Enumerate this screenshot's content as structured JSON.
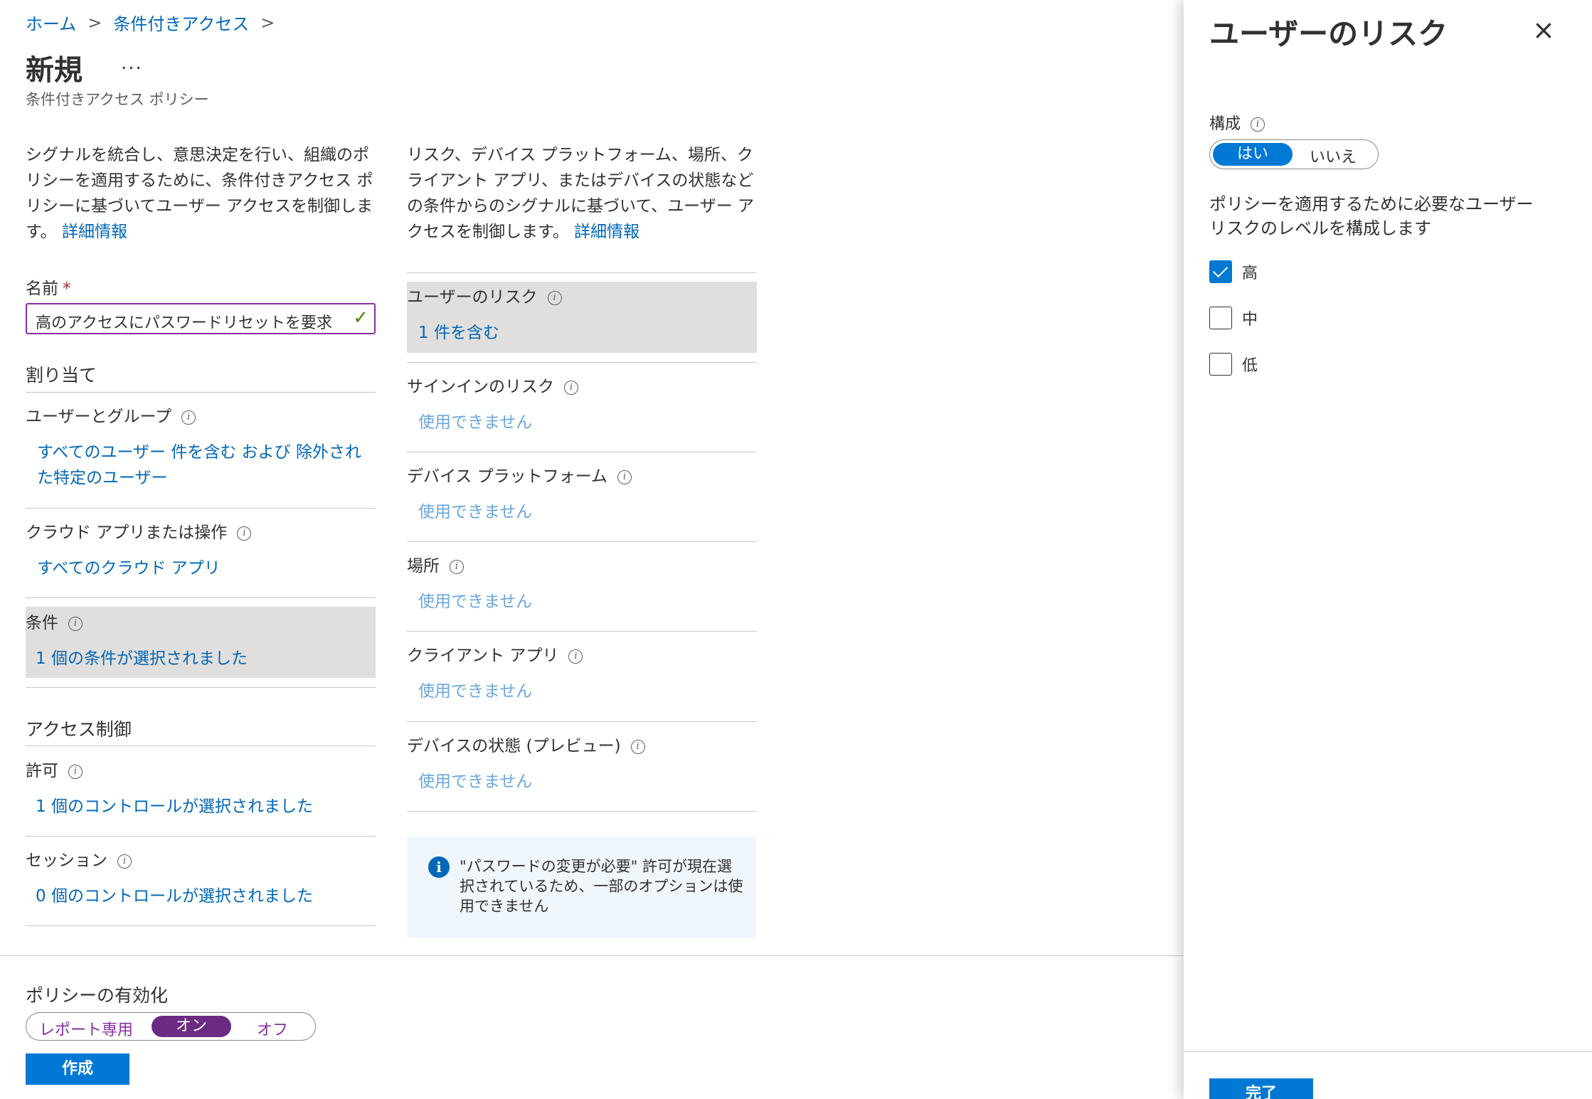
{
  "breadcrumb": {
    "items": [
      "ホーム",
      "条件付きアクセス"
    ],
    "separator": ">"
  },
  "page": {
    "title": "新規",
    "more": "...",
    "subtitle": "条件付きアクセス ポリシー"
  },
  "left": {
    "description": "シグナルを統合し、意思決定を行い、組織のポリシーを適用するために、条件付きアクセス ポリシーに基づいてユーザー アクセスを制御します。",
    "learn_more": "詳細情報",
    "name_label": "名前",
    "name_required": "*",
    "name_value": "高のアクセスにパスワードリセットを要求",
    "assign_heading": "割り当て",
    "users_label": "ユーザーとグループ",
    "users_value": "すべてのユーザー 件を含む および 除外された特定のユーザー",
    "apps_label": "クラウド アプリまたは操作",
    "apps_value": "すべてのクラウド アプリ",
    "conditions_label": "条件",
    "conditions_value": "1 個の条件が選択されました",
    "access_heading": "アクセス制御",
    "grant_label": "許可",
    "grant_value": "1 個のコントロールが選択されました",
    "session_label": "セッション",
    "session_value": "0 個のコントロールが選択されました"
  },
  "middle": {
    "description": "リスク、デバイス プラットフォーム、場所、クライアント アプリ、またはデバイスの状態などの条件からのシグナルに基づいて、ユーザー アクセスを制御します。",
    "learn_more": "詳細情報",
    "user_risk_label": "ユーザーのリスク",
    "user_risk_value": "1 件を含む",
    "signin_risk_label": "サインインのリスク",
    "signin_risk_value": "使用できません",
    "device_platform_label": "デバイス プラットフォーム",
    "device_platform_value": "使用できません",
    "location_label": "場所",
    "location_value": "使用できません",
    "client_apps_label": "クライアント アプリ",
    "client_apps_value": "使用できません",
    "device_state_label": "デバイスの状態 (プレビュー)",
    "device_state_value": "使用できません",
    "info_text": "\"パスワードの変更が必要\" 許可が現在選択されているため、一部のオプションは使用できません"
  },
  "footer": {
    "enable_label": "ポリシーの有効化",
    "options": [
      "レポート専用",
      "オン",
      "オフ"
    ],
    "selected": "オン",
    "create_button": "作成"
  },
  "panel": {
    "title": "ユーザーのリスク",
    "close": "×",
    "config_label": "構成",
    "yes": "はい",
    "no": "いいえ",
    "description": "ポリシーを適用するために必要なユーザー リスクのレベルを構成します",
    "levels": [
      {
        "label": "高",
        "checked": true
      },
      {
        "label": "中",
        "checked": false
      },
      {
        "label": "低",
        "checked": false
      }
    ],
    "done_button": "完了"
  },
  "colors": {
    "link": "#0067b8",
    "accent": "#0078d4",
    "enable_on": "#6b2a84",
    "highlight": "#e1dfdd"
  }
}
